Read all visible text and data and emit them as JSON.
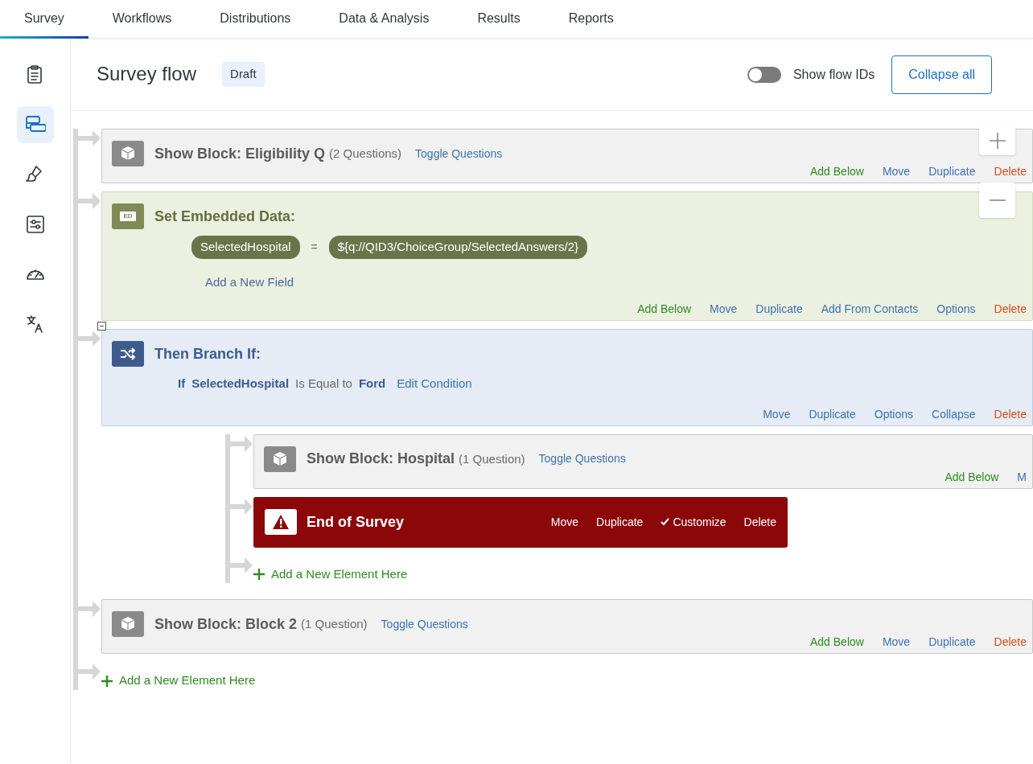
{
  "tabs": [
    {
      "label": "Survey",
      "selected": true
    },
    {
      "label": "Workflows",
      "selected": false
    },
    {
      "label": "Distributions",
      "selected": false
    },
    {
      "label": "Data & Analysis",
      "selected": false
    },
    {
      "label": "Results",
      "selected": false
    },
    {
      "label": "Reports",
      "selected": false
    }
  ],
  "sidebar": {
    "items": [
      {
        "kind": "clipboard",
        "selected": false
      },
      {
        "kind": "flow",
        "selected": true
      },
      {
        "kind": "brush",
        "selected": false
      },
      {
        "kind": "sliders",
        "selected": false
      },
      {
        "kind": "gauge",
        "selected": false
      },
      {
        "kind": "translate",
        "selected": false
      }
    ]
  },
  "header": {
    "title": "Survey flow",
    "badge": "Draft",
    "toggle": {
      "label": "Show flow IDs",
      "on": false
    },
    "button": "Collapse all"
  },
  "flow": [
    {
      "kind": "block",
      "title": "Show Block: Eligibility Q",
      "count": "(2 Questions)",
      "toggle": "Toggle Questions",
      "actions": [
        {
          "label": "Add Below",
          "kind": "add"
        },
        {
          "label": "Move",
          "kind": "normal"
        },
        {
          "label": "Duplicate",
          "kind": "normal"
        },
        {
          "label": "Delete",
          "kind": "delete"
        }
      ]
    },
    {
      "kind": "embedded_data",
      "icon_text": "ED",
      "title": "Set Embedded Data:",
      "fields": [
        {
          "name": "SelectedHospital",
          "operator": "=",
          "value": "${q://QID3/ChoiceGroup/SelectedAnswers/2}"
        }
      ],
      "add_field": "Add a New Field",
      "actions": [
        {
          "label": "Add Below",
          "kind": "add"
        },
        {
          "label": "Move",
          "kind": "normal"
        },
        {
          "label": "Duplicate",
          "kind": "normal"
        },
        {
          "label": "Add From Contacts",
          "kind": "normal"
        },
        {
          "label": "Options",
          "kind": "normal"
        },
        {
          "label": "Delete",
          "kind": "delete"
        }
      ]
    },
    {
      "kind": "branch",
      "expanded": true,
      "title": "Then Branch If:",
      "condition": {
        "prefix": "If",
        "field": "SelectedHospital",
        "operator": "Is Equal to",
        "value": "Ford",
        "edit": "Edit Condition"
      },
      "actions": [
        {
          "label": "Move",
          "kind": "normal"
        },
        {
          "label": "Duplicate",
          "kind": "normal"
        },
        {
          "label": "Options",
          "kind": "normal"
        },
        {
          "label": "Collapse",
          "kind": "normal"
        },
        {
          "label": "Delete",
          "kind": "delete"
        }
      ],
      "children": [
        {
          "kind": "block",
          "title": "Show Block: Hospital",
          "count": "(1 Question)",
          "toggle": "Toggle Questions",
          "actions": [
            {
              "label": "Add Below",
              "kind": "add"
            },
            {
              "label": "M",
              "kind": "normal"
            }
          ]
        },
        {
          "kind": "end",
          "title": "End of Survey",
          "actions": [
            {
              "label": "Move",
              "checked": false
            },
            {
              "label": "Duplicate",
              "checked": false
            },
            {
              "label": "Customize",
              "checked": true
            },
            {
              "label": "Delete",
              "checked": false
            }
          ]
        },
        {
          "kind": "add",
          "label": "Add a New Element Here"
        }
      ]
    },
    {
      "kind": "block",
      "title": "Show Block: Block 2",
      "count": "(1 Question)",
      "toggle": "Toggle Questions",
      "actions": [
        {
          "label": "Add Below",
          "kind": "add"
        },
        {
          "label": "Move",
          "kind": "normal"
        },
        {
          "label": "Duplicate",
          "kind": "normal"
        },
        {
          "label": "Delete",
          "kind": "delete"
        }
      ]
    },
    {
      "kind": "add",
      "label": "Add a New Element Here"
    }
  ]
}
